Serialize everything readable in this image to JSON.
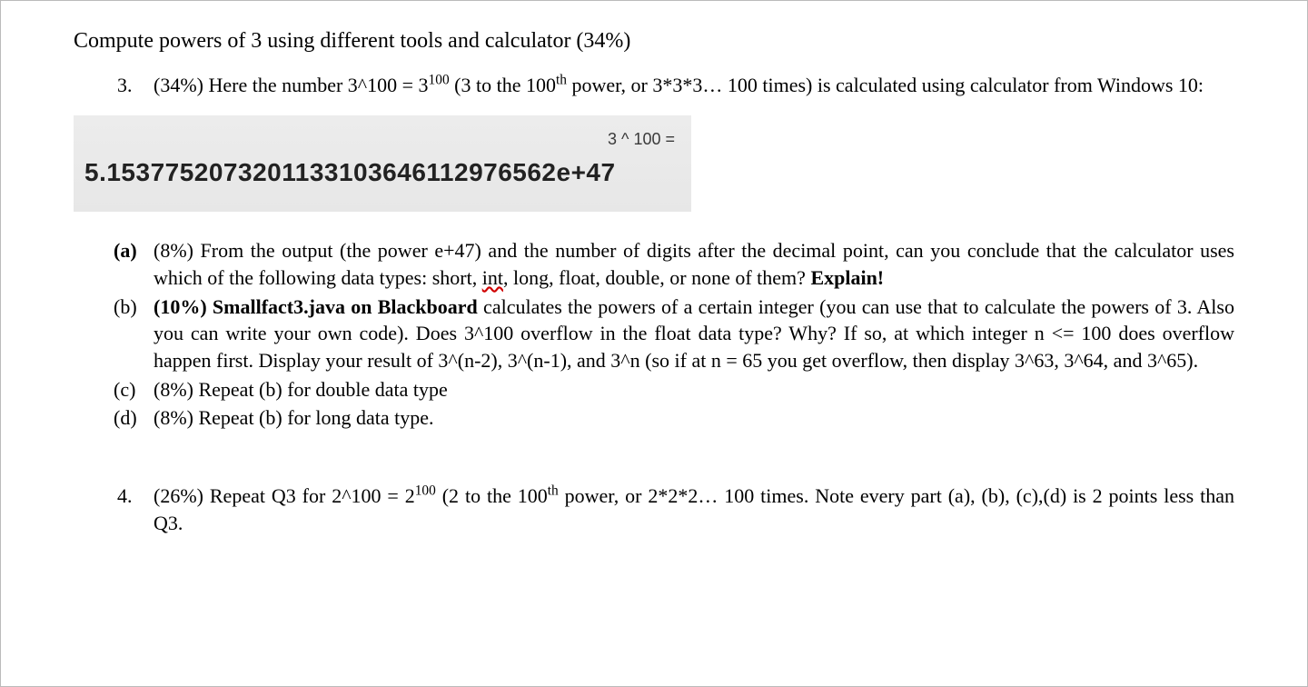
{
  "title": "Compute powers of 3 using different tools and calculator (34%)",
  "q3": {
    "num": "3.",
    "intro_a": "(34%) Here the number 3^100 = 3",
    "intro_exp1": "100",
    "intro_b": "  (3 to the 100",
    "intro_th": "th",
    "intro_c": " power, or 3*3*3…  100 times) is calculated using calculator from Windows 10:"
  },
  "calc": {
    "expr": "3 ^ 100 =",
    "result": "5.1537752073201133103646112976562e+47"
  },
  "parts": {
    "a": {
      "label": "(a)",
      "lead": "(8%) From the output (the power e+47) and the number of digits after the decimal point, can you conclude that the calculator uses which of the following data types: short, ",
      "flag": "int",
      "mid": ", long, float, double, or none of them? ",
      "bold": "Explain!"
    },
    "b": {
      "label": "(b)",
      "bold": "(10%) Smallfact3.java on Blackboard",
      "rest": " calculates the powers of a certain integer (you can use that to calculate the powers of 3. Also you can write your own code).  Does 3^100 overflow in the float data type? Why? If so, at which integer n <= 100 does overflow happen first. Display your result of 3^(n-2), 3^(n-1), and 3^n (so if at n = 65 you get overflow, then display 3^63, 3^64, and 3^65)."
    },
    "c": {
      "label": "(c)",
      "text": "(8%) Repeat (b) for double data type"
    },
    "d": {
      "label": "(d)",
      "text": "(8%) Repeat (b) for long data type."
    }
  },
  "q4": {
    "num": "4.",
    "a": "(26%) Repeat Q3 for 2^100 = 2",
    "exp1": "100",
    "b": "  (2 to the 100",
    "th": "th",
    "c": " power, or 2*2*2…  100 times. Note every part (a), (b), (c),(d) is 2 points less than Q3."
  }
}
